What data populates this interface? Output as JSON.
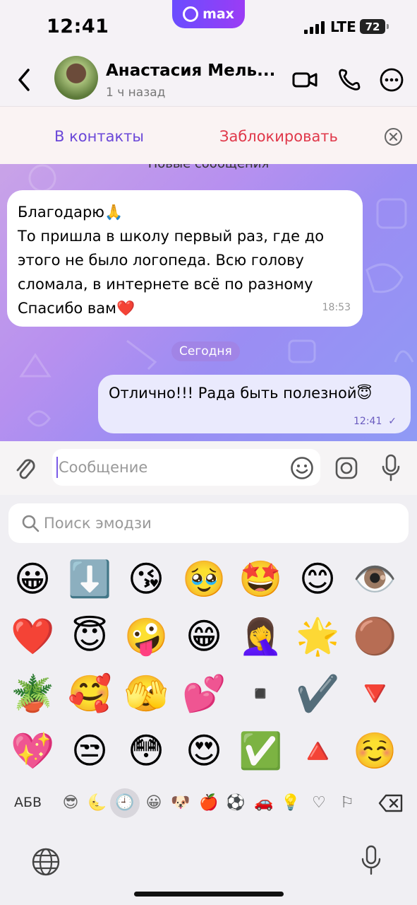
{
  "status_bar": {
    "time": "12:41",
    "app_badge": "max",
    "network": "LTE",
    "battery": "72"
  },
  "header": {
    "contact_name": "Анастасия Мель...",
    "last_seen": "1 ч назад",
    "icons": [
      "back-icon",
      "video-call-icon",
      "phone-icon",
      "more-icon"
    ]
  },
  "action_bar": {
    "add_contact": "В контакты",
    "block": "Заблокировать"
  },
  "chat": {
    "new_messages_label": "Новые сообщения",
    "incoming": {
      "lines": [
        "Благодарю🙏",
        "То пришла в школу первый раз, где до",
        "этого не было логопеда. Всю голову",
        "сломала, в интернете всё по разному",
        "Спасибо вам❤️"
      ],
      "time": "18:53"
    },
    "date_chip": "Сегодня",
    "outgoing": {
      "text": "Отлично!!! Рада быть полезной😇",
      "time": "12:41",
      "status": "✓"
    }
  },
  "composer": {
    "placeholder": "Сообщение"
  },
  "emoji_panel": {
    "search_placeholder": "Поиск эмодзи",
    "rows": [
      [
        "😀",
        "⬇️",
        "😘",
        "🥹",
        "🤩",
        "😊",
        "👁️"
      ],
      [
        "❤️",
        "😇",
        "🤪",
        "😁",
        "🤦‍♀️",
        "🌟",
        "🟤"
      ],
      [
        "🪴",
        "🥰",
        "🫣",
        "💕",
        "▪️",
        "✔️",
        "🔻"
      ],
      [
        "💖",
        "😒",
        "😳",
        "😍",
        "✅",
        "🔺",
        "☺️"
      ]
    ],
    "category_label": "АБВ",
    "categories": [
      "😎",
      "🌜",
      "🕘",
      "😀",
      "🐶",
      "🍎",
      "⚽",
      "🚗",
      "💡",
      "♡",
      "⚐"
    ]
  }
}
